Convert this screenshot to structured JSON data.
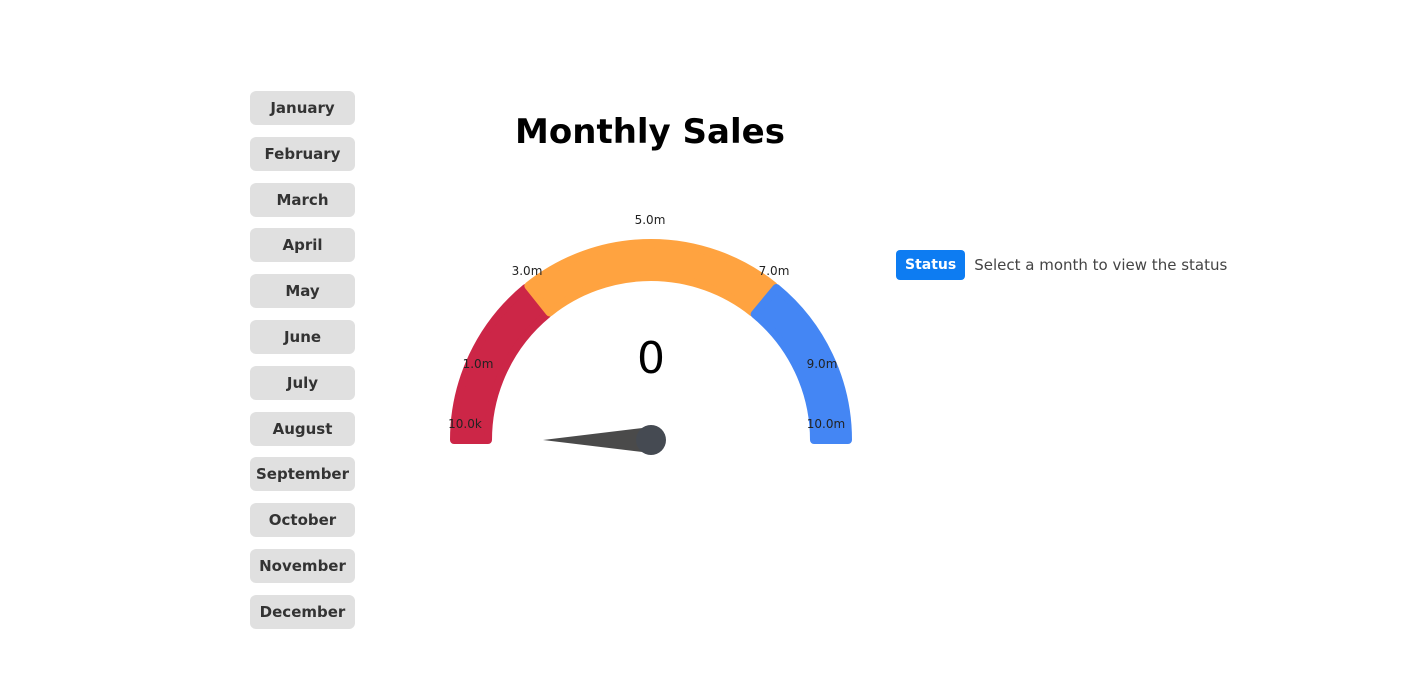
{
  "months": [
    "January",
    "February",
    "March",
    "April",
    "May",
    "June",
    "July",
    "August",
    "September",
    "October",
    "November",
    "December"
  ],
  "chart_title": "Monthly Sales",
  "chart_data": {
    "type": "gauge",
    "title": "Monthly Sales",
    "value": 0,
    "value_label": "0",
    "min": 10000,
    "max": 10000000,
    "tick_labels": [
      "10.0k",
      "1.0m",
      "3.0m",
      "5.0m",
      "7.0m",
      "9.0m",
      "10.0m"
    ],
    "bands": [
      {
        "from": "10.0k",
        "to": "3.0m",
        "color": "#cc2647"
      },
      {
        "from": "3.0m",
        "to": "7.0m",
        "color": "#ffa340"
      },
      {
        "from": "7.0m",
        "to": "10.0m",
        "color": "#4486f4"
      }
    ],
    "needle_color": "#4a4a4a"
  },
  "status": {
    "badge_label": "Status",
    "message": "Select a month to view the status"
  }
}
